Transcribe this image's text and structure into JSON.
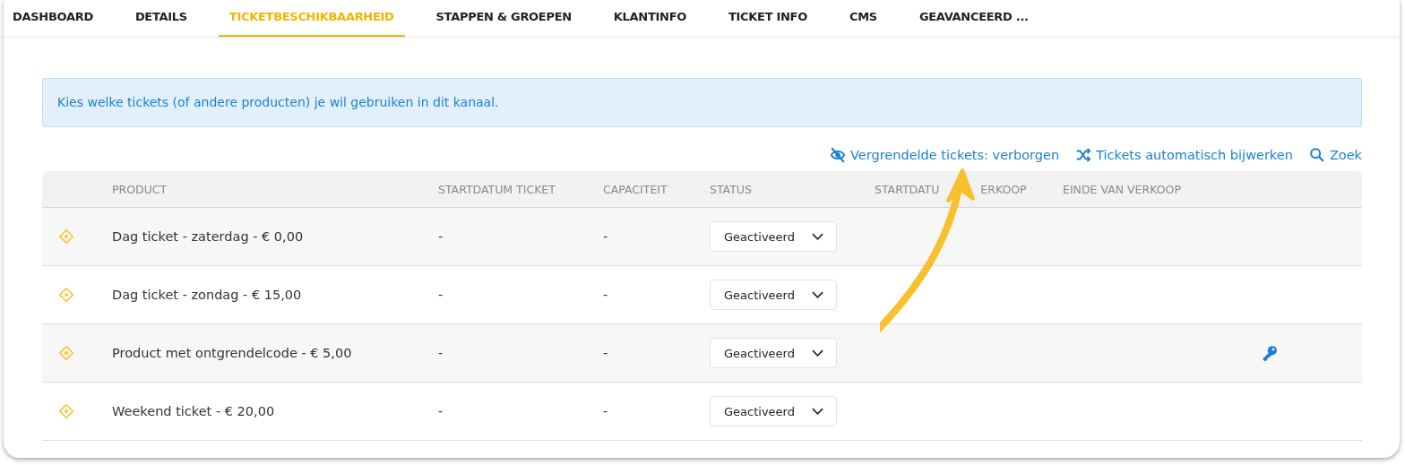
{
  "tabs": [
    {
      "label": "DASHBOARD",
      "selected": false
    },
    {
      "label": "DETAILS",
      "selected": false
    },
    {
      "label": "TICKETBESCHIKBAARHEID",
      "selected": true
    },
    {
      "label": "STAPPEN & GROEPEN",
      "selected": false
    },
    {
      "label": "KLANTINFO",
      "selected": false
    },
    {
      "label": "TICKET INFO",
      "selected": false
    },
    {
      "label": "CMS",
      "selected": false
    },
    {
      "label": "GEAVANCEERD ...",
      "selected": false
    }
  ],
  "info": "Kies welke tickets (of andere producten) je wil gebruiken in dit kanaal.",
  "actions": [
    {
      "kind": "hidden",
      "label": "Vergrendelde tickets: verborgen"
    },
    {
      "kind": "shuffle",
      "label": "Tickets automatisch bijwerken"
    },
    {
      "kind": "search",
      "label": "Zoek"
    }
  ],
  "table": {
    "columns": [
      "PRODUCT",
      "STARTDATUM TICKET",
      "CAPACITEIT",
      "STATUS",
      [
        "STARTDATU",
        "ERKOOP"
      ],
      "EINDE VAN VERKOOP"
    ],
    "rows": [
      {
        "product": "Dag ticket - zaterdag - € 0,00",
        "start": "-",
        "capacity": "-",
        "status": "Geactiveerd",
        "locked": false
      },
      {
        "product": "Dag ticket - zondag - € 15,00",
        "start": "-",
        "capacity": "-",
        "status": "Geactiveerd",
        "locked": false
      },
      {
        "product": "Product met ontgrendelcode - € 5,00",
        "start": "-",
        "capacity": "-",
        "status": "Geactiveerd",
        "locked": true
      },
      {
        "product": "Weekend ticket - € 20,00",
        "start": "-",
        "capacity": "-",
        "status": "Geactiveerd",
        "locked": false
      }
    ]
  }
}
